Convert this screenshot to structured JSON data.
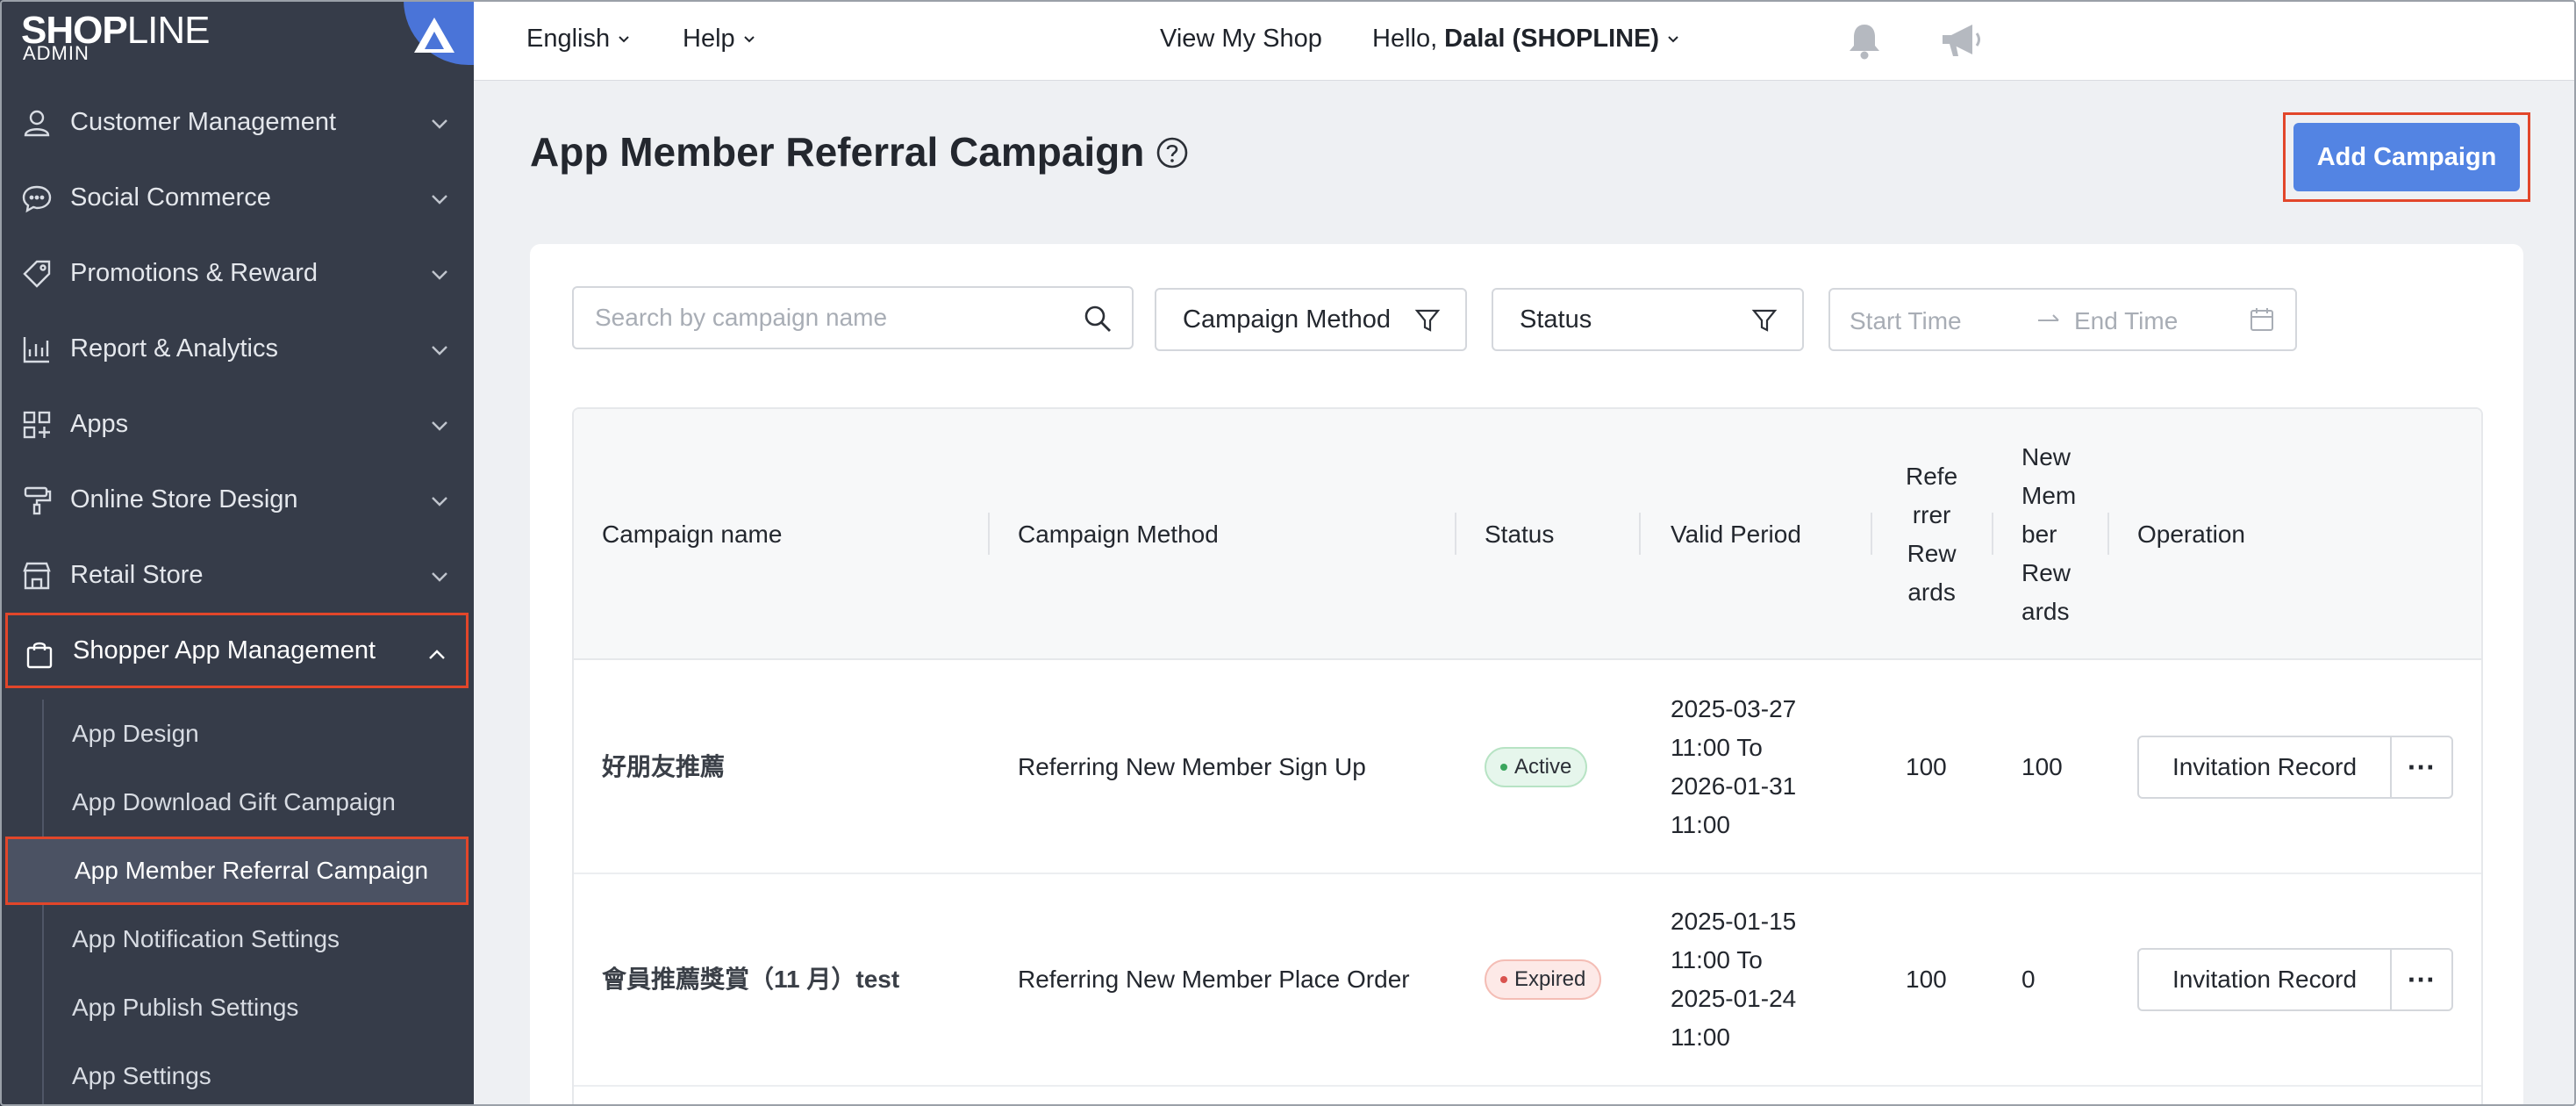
{
  "brand": {
    "logo_main": "SHOP",
    "logo_thin": "LINE",
    "logo_sub": "ADMIN"
  },
  "sidebar": {
    "items": [
      {
        "label": "Customer Management",
        "icon": "user-icon"
      },
      {
        "label": "Social Commerce",
        "icon": "chat-icon"
      },
      {
        "label": "Promotions & Reward",
        "icon": "tag-icon"
      },
      {
        "label": "Report & Analytics",
        "icon": "chart-icon"
      },
      {
        "label": "Apps",
        "icon": "apps-icon"
      },
      {
        "label": "Online Store Design",
        "icon": "paint-roller-icon"
      },
      {
        "label": "Retail Store",
        "icon": "store-icon"
      },
      {
        "label": "Shopper App Management",
        "icon": "shopping-bag-icon"
      }
    ],
    "subitems": [
      {
        "label": "App Design"
      },
      {
        "label": "App Download Gift Campaign"
      },
      {
        "label": "App Member Referral Campaign"
      },
      {
        "label": "App Notification Settings"
      },
      {
        "label": "App Publish Settings"
      },
      {
        "label": "App Settings"
      }
    ]
  },
  "topbar": {
    "language": "English",
    "help": "Help",
    "view_shop": "View My Shop",
    "greeting": "Hello,",
    "user": "Dalal (SHOPLINE)"
  },
  "page": {
    "title": "App Member Referral Campaign",
    "add_button": "Add Campaign"
  },
  "filters": {
    "search_placeholder": "Search by campaign name",
    "method": "Campaign Method",
    "status": "Status",
    "start_placeholder": "Start Time",
    "end_placeholder": "End Time"
  },
  "table": {
    "headers": {
      "name": "Campaign name",
      "method": "Campaign Method",
      "status": "Status",
      "period": "Valid Period",
      "referrer_lines": [
        "Refe",
        "rrer",
        "Rew",
        "ards"
      ],
      "newmember_lines": [
        "New",
        "Mem",
        "ber",
        "Rew",
        "ards"
      ],
      "operation": "Operation"
    },
    "rows": [
      {
        "name": "好朋友推薦",
        "method": "Referring New Member Sign Up",
        "status": "Active",
        "period_lines": [
          "2025-03-27",
          "11:00 To",
          "2026-01-31",
          "11:00"
        ],
        "referrer": "100",
        "newmember": "100",
        "op_button": "Invitation Record",
        "more": "···"
      },
      {
        "name": "會員推薦獎賞（11 月）test",
        "method": "Referring New Member Place Order",
        "status": "Expired",
        "period_lines": [
          "2025-01-15",
          "11:00 To",
          "2025-01-24",
          "11:00"
        ],
        "referrer": "100",
        "newmember": "0",
        "op_button": "Invitation Record",
        "more": "···"
      }
    ]
  },
  "colors": {
    "sidebar_bg": "#363c49",
    "accent": "#5384e3",
    "highlight_border": "#e2462a"
  }
}
